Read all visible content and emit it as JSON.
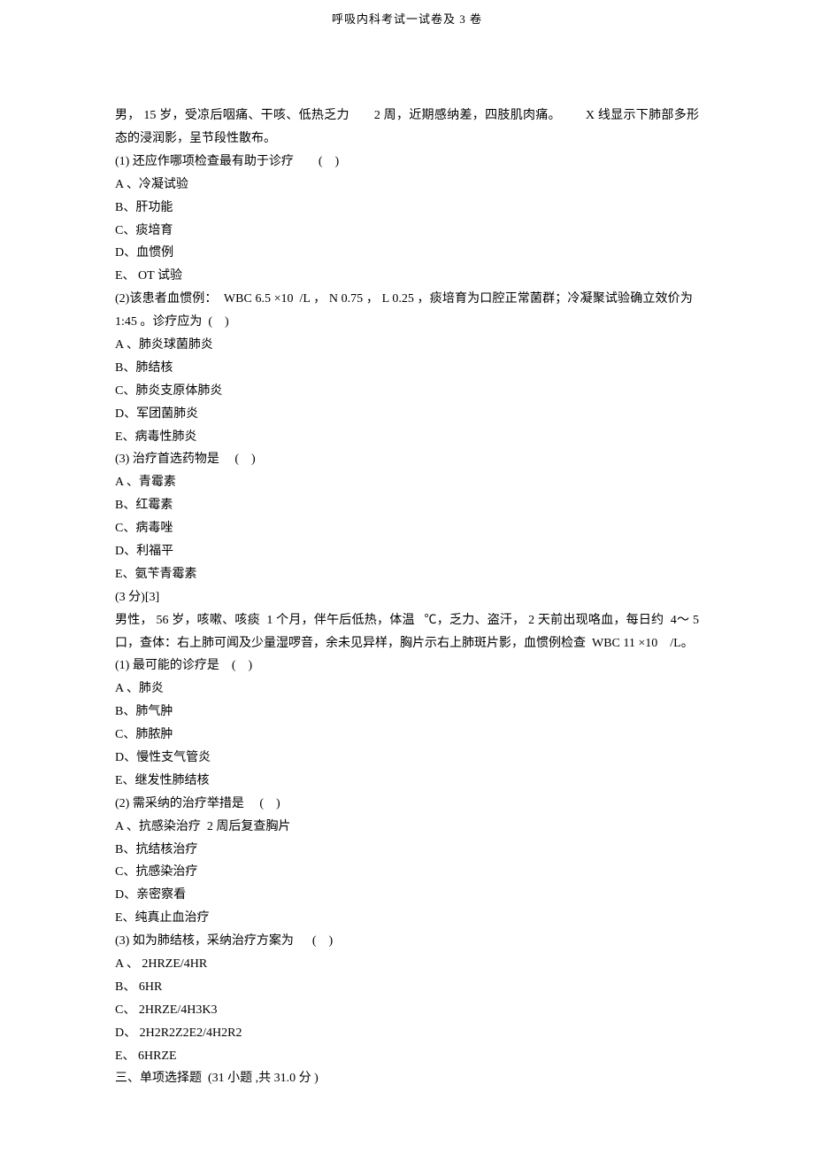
{
  "header": "呼吸内科考试一试卷及 3 卷",
  "case1_intro": "男， 15 岁，受凉后咽痛、干咳、低热乏力  2 周，近期感纳差，四肢肌肉痛。  X 线显示下肺部多形态的浸润影，呈节段性散布。",
  "case1_q1": "(1) 还应作哪项检查最有助于诊疗  ( )",
  "case1_q1_a": "A 、冷凝试验",
  "case1_q1_b": "B、肝功能",
  "case1_q1_c": "C、痰培育",
  "case1_q1_d": "D、血惯例",
  "case1_q1_e": "E、 OT 试验",
  "case1_q2": "(2)该患者血惯例：  WBC 6.5 ×10 /L ， N 0.75 ， L 0.25 ，痰培育为口腔正常菌群；冷凝聚试验确立效价为 1:45 。诊疗应为 ( )",
  "case1_q2_a": "A 、肺炎球菌肺炎",
  "case1_q2_b": "B、肺结核",
  "case1_q2_c": "C、肺炎支原体肺炎",
  "case1_q2_d": "D、军团菌肺炎",
  "case1_q2_e": "E、病毒性肺炎",
  "case1_q3": "(3) 治疗首选药物是  ( )",
  "case1_q3_a": "A 、青霉素",
  "case1_q3_b": "B、红霉素",
  "case1_q3_c": "C、病毒唑",
  "case1_q3_d": "D、利福平",
  "case1_q3_e": "E、氨苄青霉素",
  "score_note": "(3 分)[3]",
  "case2_intro": "男性， 56 岁，咳嗽、咳痰  1 个月，伴午后低热，体温  ℃，乏力、盗汗， 2 天前出现咯血，每日约  4～ 5 口，查体：右上肺可闻及少量湿啰音，余未见异样，胸片示右上肺斑片影，血惯例检查  WBC 11 ×10 /L。",
  "case2_q1": "(1) 最可能的诊疗是 ( )",
  "case2_q1_a": "A 、肺炎",
  "case2_q1_b": "B、肺气肿",
  "case2_q1_c": "C、肺脓肿",
  "case2_q1_d": "D、慢性支气管炎",
  "case2_q1_e": "E、继发性肺结核",
  "case2_q2": "(2) 需采纳的治疗举措是  ( )",
  "case2_q2_a": "A 、抗感染治疗 2 周后复查胸片",
  "case2_q2_b": "B、抗结核治疗",
  "case2_q2_c": "C、抗感染治疗",
  "case2_q2_d": "D、亲密察看",
  "case2_q2_e": "E、纯真止血治疗",
  "case2_q3": "(3) 如为肺结核，采纳治疗方案为   ( )",
  "case2_q3_a": "A 、 2HRZE/4HR",
  "case2_q3_b": "B、 6HR",
  "case2_q3_c": "C、 2HRZE/4H3K3",
  "case2_q3_d": "D、 2H2R2Z2E2/4H2R2",
  "case2_q3_e": "E、 6HRZE",
  "section3": "三、单项选择题  (31 小题 ,共 31.0 分 )"
}
